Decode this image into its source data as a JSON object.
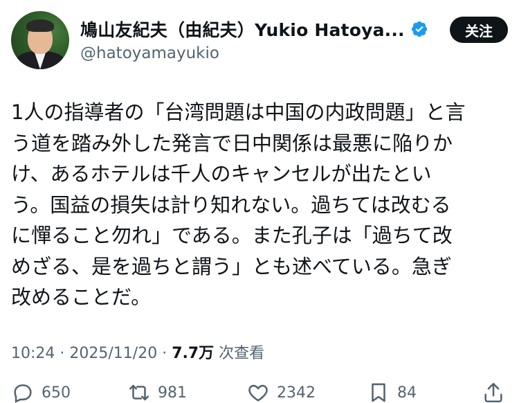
{
  "header": {
    "display_name": "鳩山友紀夫（由紀夫）Yukio Hatoya...",
    "handle": "@hatoyamayukio",
    "follow_label": "关注"
  },
  "tweet": {
    "text": "1人の指導者の「台湾問題は中国の内政問題」と言\nう道を踏み外した発言で日中関係は最悪に陥りか\nけ、あるホテルは千人のキャンセルが出たとい\nう。国益の損失は計り知れない。過ちては改むる\nに憚ること勿れ」である。また孔子は「過ちて改\nめざる、是を過ちと謂う」とも述べている。急ぎ\n改めることだ。"
  },
  "meta": {
    "time": "10:24",
    "separator": " · ",
    "date": "2025/11/20",
    "views_count": "7.7万",
    "views_label": " 次查看"
  },
  "actions": {
    "replies": "650",
    "retweets": "981",
    "likes": "2342",
    "bookmarks": "84"
  },
  "colors": {
    "verified": "#1d9bf0",
    "secondary_text": "#536471",
    "primary_text": "#0f1419"
  }
}
